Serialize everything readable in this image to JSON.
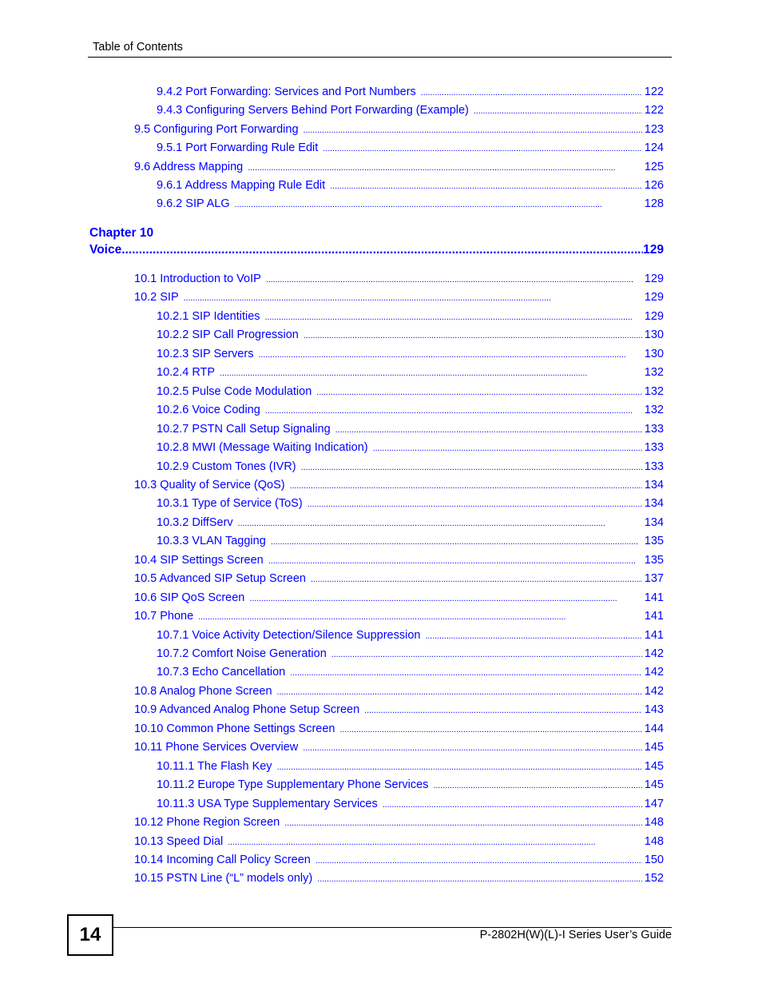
{
  "header": {
    "running_head": "Table of Contents"
  },
  "toc_before": [
    {
      "level": 3,
      "label": "9.4.2 Port Forwarding: Services and Port Numbers",
      "page": "122"
    },
    {
      "level": 3,
      "label": "9.4.3 Configuring Servers Behind Port Forwarding (Example)",
      "page": "122"
    },
    {
      "level": 2,
      "label": "9.5 Configuring Port Forwarding",
      "page": "123"
    },
    {
      "level": 3,
      "label": "9.5.1 Port Forwarding Rule Edit",
      "page": "124"
    },
    {
      "level": 2,
      "label": "9.6 Address Mapping",
      "page": "125"
    },
    {
      "level": 3,
      "label": "9.6.1 Address Mapping Rule Edit",
      "page": "126"
    },
    {
      "level": 3,
      "label": "9.6.2 SIP ALG",
      "page": "128"
    }
  ],
  "chapter": {
    "number_label": "Chapter  10",
    "title": "Voice",
    "page": "129"
  },
  "toc_after": [
    {
      "level": 2,
      "label": "10.1 Introduction to VoIP",
      "page": "129"
    },
    {
      "level": 2,
      "label": "10.2  SIP",
      "page": "129"
    },
    {
      "level": 3,
      "label": "10.2.1 SIP Identities",
      "page": "129"
    },
    {
      "level": 3,
      "label": "10.2.2 SIP Call Progression",
      "page": "130"
    },
    {
      "level": 3,
      "label": "10.2.3 SIP Servers",
      "page": "130"
    },
    {
      "level": 3,
      "label": "10.2.4 RTP",
      "page": "132"
    },
    {
      "level": 3,
      "label": "10.2.5 Pulse Code Modulation",
      "page": "132"
    },
    {
      "level": 3,
      "label": "10.2.6 Voice Coding",
      "page": "132"
    },
    {
      "level": 3,
      "label": "10.2.7 PSTN Call Setup Signaling",
      "page": "133"
    },
    {
      "level": 3,
      "label": "10.2.8 MWI (Message Waiting Indication)",
      "page": "133"
    },
    {
      "level": 3,
      "label": "10.2.9 Custom Tones (IVR)",
      "page": "133"
    },
    {
      "level": 2,
      "label": "10.3 Quality of Service (QoS)",
      "page": "134"
    },
    {
      "level": 3,
      "label": "10.3.1 Type of Service (ToS)",
      "page": "134"
    },
    {
      "level": 3,
      "label": "10.3.2 DiffServ",
      "page": "134"
    },
    {
      "level": 3,
      "label": "10.3.3 VLAN Tagging",
      "page": "135"
    },
    {
      "level": 2,
      "label": "10.4 SIP Settings Screen",
      "page": "135"
    },
    {
      "level": 2,
      "label": "10.5 Advanced SIP Setup Screen",
      "page": "137"
    },
    {
      "level": 2,
      "label": "10.6 SIP QoS Screen",
      "page": "141"
    },
    {
      "level": 2,
      "label": "10.7 Phone",
      "page": "141"
    },
    {
      "level": 3,
      "label": "10.7.1 Voice Activity Detection/Silence Suppression",
      "page": "141"
    },
    {
      "level": 3,
      "label": "10.7.2 Comfort Noise Generation",
      "page": "142"
    },
    {
      "level": 3,
      "label": "10.7.3 Echo Cancellation",
      "page": "142"
    },
    {
      "level": 2,
      "label": "10.8 Analog Phone Screen",
      "page": "142"
    },
    {
      "level": 2,
      "label": "10.9 Advanced Analog Phone Setup Screen",
      "page": "143"
    },
    {
      "level": 2,
      "label": "10.10 Common Phone Settings Screen",
      "page": "144"
    },
    {
      "level": 2,
      "label": "10.11 Phone Services Overview",
      "page": "145"
    },
    {
      "level": 3,
      "label": "10.11.1 The Flash Key",
      "page": "145"
    },
    {
      "level": 3,
      "label": "10.11.2 Europe Type Supplementary Phone Services",
      "page": "145"
    },
    {
      "level": 3,
      "label": "10.11.3 USA Type Supplementary Services",
      "page": "147"
    },
    {
      "level": 2,
      "label": "10.12 Phone Region Screen",
      "page": "148"
    },
    {
      "level": 2,
      "label": "10.13 Speed Dial",
      "page": "148"
    },
    {
      "level": 2,
      "label": "10.14 Incoming Call Policy Screen",
      "page": "150"
    },
    {
      "level": 2,
      "label": "10.15 PSTN Line (“L” models only)",
      "page": "152"
    }
  ],
  "footer": {
    "page_number": "14",
    "guide_title": "P-2802H(W)(L)-I Series User’s Guide"
  },
  "colors": {
    "link": "#0000ff",
    "text": "#000000"
  }
}
